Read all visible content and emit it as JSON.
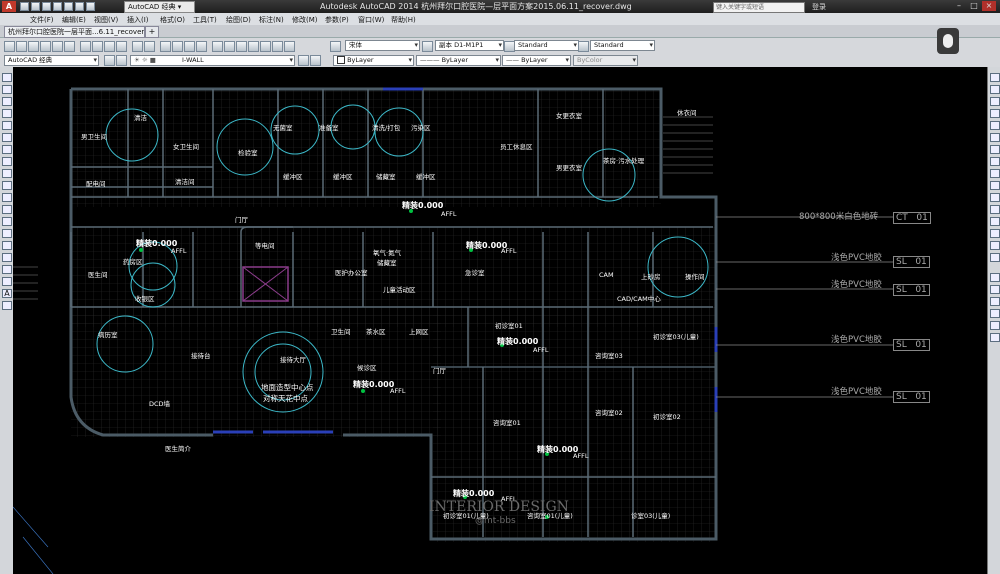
{
  "window": {
    "title": "Autodesk AutoCAD 2014    杭州拜尔口腔医院—层平面方案2015.06.11_recover.dwg",
    "search_placeholder": "键入关键字或短语",
    "signin_label": "登录"
  },
  "workspace": {
    "current": "AutoCAD 经典"
  },
  "menu": [
    "文件(F)",
    "编辑(E)",
    "视图(V)",
    "插入(I)",
    "格式(O)",
    "工具(T)",
    "绘图(D)",
    "标注(N)",
    "修改(M)",
    "参数(P)",
    "窗口(W)",
    "帮助(H)"
  ],
  "document_tab": {
    "label": "杭州拜尔口腔医院一层平面...6.11_recover*"
  },
  "toolbar": {
    "font_combo": "宋体",
    "dim_style_combo": "副本 D1-M1P1",
    "table_style_combo": "Standard",
    "mleader_style_combo": "Standard",
    "workspace_combo": "AutoCAD 经典",
    "layer_combo": "I-WALL",
    "color_combo": "ByLayer",
    "linetype_combo": "ByLayer",
    "lineweight_combo": "ByLayer",
    "plotstyle_combo": "ByColor"
  },
  "plan": {
    "rooms": [
      "男卫生间",
      "清洁",
      "女卫生间",
      "清洁间",
      "配电间",
      "检验室",
      "无菌室",
      "准备室",
      "清洗/打包",
      "污染区",
      "缓冲区",
      "缓冲区",
      "储藏室",
      "缓冲区",
      "员工休息区",
      "女更衣室",
      "男更衣室",
      "茶房·污水处理",
      "休衣间",
      "药房区",
      "医生间",
      "收银区",
      "病历室",
      "接待台",
      "接待大厅",
      "候诊区",
      "等电间",
      "医护办公室",
      "氧气·氮气",
      "储藏室",
      "儿童活动区",
      "急诊室",
      "CAM",
      "上砂房",
      "操作间",
      "CAD/CAM中心",
      "初诊室01",
      "咨询室01",
      "初诊室03(儿童)",
      "咨询室03",
      "咨询室02",
      "初诊室02",
      "初诊室01(儿童)",
      "咨询室01(儿童)",
      "诊室03(儿童)",
      "医生简介",
      "门厅",
      "门厅",
      "卫生间",
      "茶水区",
      "上网区",
      "DCD墙"
    ],
    "elevation_labels": [
      "精装0.000",
      "精装0.000",
      "精装0.000",
      "精装0.000",
      "精装0.000",
      "精装0.000",
      "精装0.000"
    ],
    "affl_label": "AFFL",
    "center_note": [
      "地面造型中心点",
      "对称天花中点"
    ],
    "watermark": [
      "INTERIOR DESIGN",
      "@mt-bbs"
    ]
  },
  "legend": [
    {
      "text": "800*800米白色地砖",
      "code": "CT",
      "num": "01"
    },
    {
      "text": "浅色PVC地胶",
      "code": "SL",
      "num": "01"
    },
    {
      "text": "浅色PVC地胶",
      "code": "SL",
      "num": "01"
    },
    {
      "text": "浅色PVC地胶",
      "code": "SL",
      "num": "01"
    },
    {
      "text": "浅色PVC地胶",
      "code": "SL",
      "num": "01"
    }
  ],
  "colors": {
    "walls": "#3a4a55",
    "dim": "#cfcfcf",
    "green_marker": "#00c040",
    "cyan_circle": "#3cb8c8",
    "legend": "#a8a8a8"
  }
}
